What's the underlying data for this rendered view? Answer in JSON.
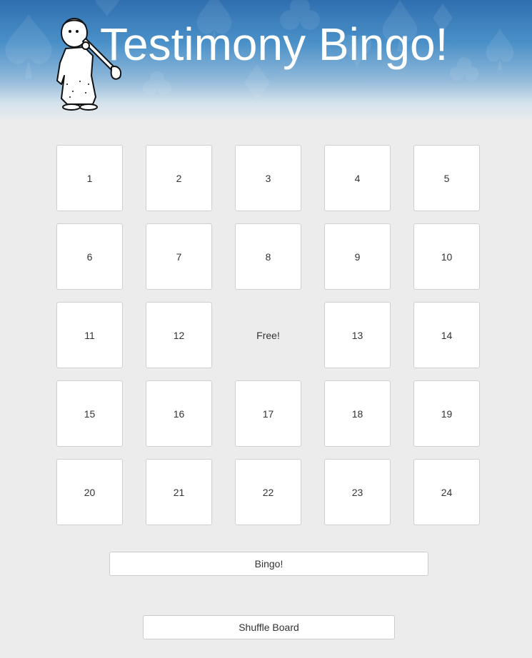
{
  "header": {
    "title": "Testimony Bingo!",
    "background_colors": [
      "#2f6fb0",
      "#4a90c8",
      "#ececec"
    ]
  },
  "board": {
    "rows": [
      [
        "1",
        "2",
        "3",
        "4",
        "5"
      ],
      [
        "6",
        "7",
        "8",
        "9",
        "10"
      ],
      [
        "11",
        "12",
        "Free!",
        "13",
        "14"
      ],
      [
        "15",
        "16",
        "17",
        "18",
        "19"
      ],
      [
        "20",
        "21",
        "22",
        "23",
        "24"
      ]
    ]
  },
  "buttons": {
    "bingo_label": "Bingo!",
    "shuffle_label": "Shuffle Board"
  },
  "icons": {
    "mascot": "child-playing-trumpet-icon",
    "background_pattern": "card-suits-pattern"
  }
}
